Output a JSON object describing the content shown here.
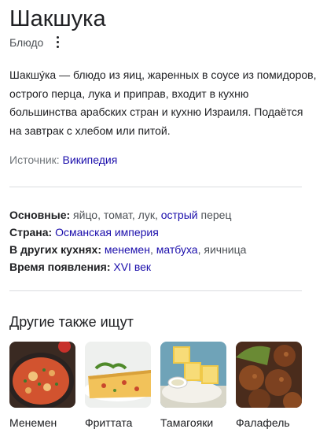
{
  "header": {
    "title": "Шакшука",
    "subtitle": "Блюдо"
  },
  "description": "Шакшу́ка — блюдо из яиц, жаренных в соусе из помидоров, острого перца, лука и приправ, входит в кухню большинства арабских стран и кухню Израиля. Подаётся на завтрак с хлебом или питой.",
  "source": {
    "label": "Источник:",
    "link": "Википедия"
  },
  "facts": {
    "ingredients": {
      "label": "Основные:",
      "text_before": "яйцо, томат, лук,",
      "link": "острый",
      "text_after": "перец"
    },
    "country": {
      "label": "Страна:",
      "link": "Османская империя"
    },
    "other_cuisines": {
      "label": "В других кухнях:",
      "link1": "менемен",
      "sep": ",",
      "link2": "матбуха",
      "text_after": ", яичница"
    },
    "time": {
      "label": "Время появления:",
      "link": "XVI век"
    }
  },
  "related": {
    "title": "Другие также ищут",
    "items": [
      {
        "label": "Менемен"
      },
      {
        "label": "Фриттата"
      },
      {
        "label": "Тамагояки"
      },
      {
        "label": "Фалафель"
      }
    ]
  },
  "colors": {
    "link": "#1a0dab",
    "text": "#202124",
    "secondary": "#70757a",
    "divider": "#dadce0"
  }
}
